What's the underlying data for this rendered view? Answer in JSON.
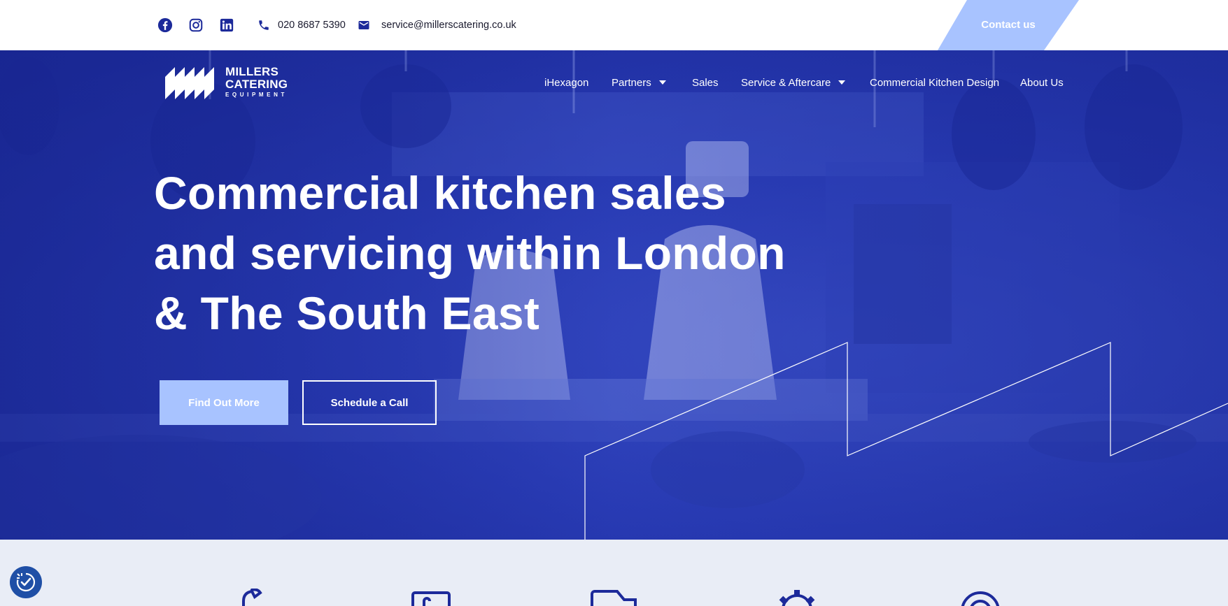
{
  "topbar": {
    "phone": "020 8687 5390",
    "email": "service@millerscatering.co.uk",
    "contact_button": "Contact us",
    "social_icons": [
      "facebook-icon",
      "instagram-icon",
      "linkedin-icon"
    ]
  },
  "logo": {
    "line1": "MILLERS",
    "line2": "CATERING",
    "line3": "EQUIPMENT"
  },
  "nav": {
    "items": [
      {
        "label": "iHexagon",
        "has_dropdown": false
      },
      {
        "label": "Partners",
        "has_dropdown": true
      },
      {
        "label": "Sales",
        "has_dropdown": false
      },
      {
        "label": "Service & Aftercare",
        "has_dropdown": true
      },
      {
        "label": "Commercial Kitchen Design",
        "has_dropdown": false
      },
      {
        "label": "About Us",
        "has_dropdown": false
      }
    ]
  },
  "hero": {
    "headline_lines": [
      "Commercial kitchen sales",
      "and servicing within London",
      "& The South East"
    ],
    "primary_button": "Find Out More",
    "secondary_button": "Schedule a Call"
  },
  "features": {
    "icons": [
      "wrench-icon",
      "tablet-icon",
      "truck-icon",
      "gear-icon",
      "target-icon"
    ]
  },
  "colors": {
    "brand_blue": "#1c2a9a",
    "light_blue": "#a8c3ff",
    "strip_bg": "#e9edf6",
    "icon_blue": "#1c2a9a"
  }
}
